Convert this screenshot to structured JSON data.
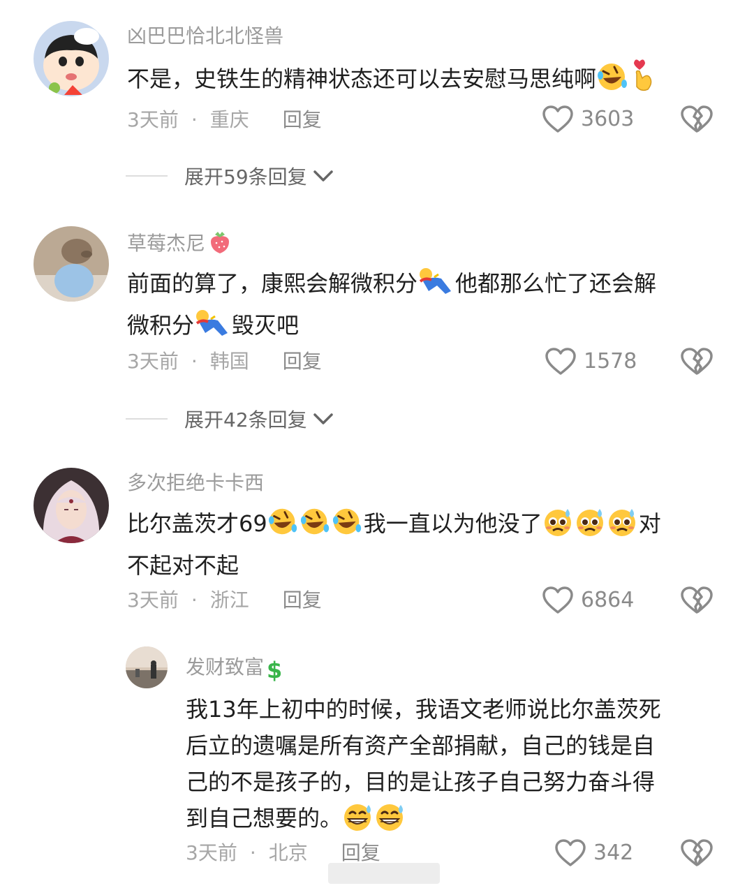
{
  "comments": [
    {
      "username": "凶巴巴恰北北怪兽",
      "text": "不是，史铁生的精神状态还可以去安慰马思纯啊",
      "time": "3天前",
      "location": "重庆",
      "reply_label": "回复",
      "likes": "3603",
      "expand_label": "展开59条回复",
      "emojis": [
        "rofl-emoji",
        "finger-heart-emoji"
      ]
    },
    {
      "username": "草莓杰尼",
      "text_line1": "前面的算了，康熙会解微积分",
      "text_mid": "他都那么忙了还会解",
      "text_line2a": "微积分",
      "text_line2b": "毁灭吧",
      "time": "3天前",
      "location": "韩国",
      "reply_label": "回复",
      "likes": "1578",
      "expand_label": "展开42条回复",
      "emojis": [
        "strawberry-emoji",
        "fallen-person-emoji"
      ]
    },
    {
      "username": "多次拒绝卡卡西",
      "text_a": "比尔盖茨才69",
      "text_b": "我一直以为他没了",
      "text_c": "对",
      "text_line2": "不起对不起",
      "time": "3天前",
      "location": "浙江",
      "reply_label": "回复",
      "likes": "6864",
      "emojis": [
        "rofl-emoji",
        "pleading-sweat-emoji"
      ]
    },
    {
      "username": "发财致富",
      "text_lines": [
        "我13年上初中的时候，我语文老师说比尔盖茨死",
        "后立的遗嘱是所有资产全部捐献，自己的钱是自",
        "己的不是孩子的，目的是让孩子自己努力奋斗得",
        "到自己想要的。"
      ],
      "time": "3天前",
      "location": "北京",
      "reply_label": "回复",
      "likes": "342",
      "emojis": [
        "dollar-emoji",
        "grin-sweat-emoji"
      ]
    }
  ],
  "colors": {
    "username": "#9b9b9b",
    "text": "#1f1f1f",
    "meta": "#a6a6a6",
    "icon": "#8a8a8a"
  }
}
